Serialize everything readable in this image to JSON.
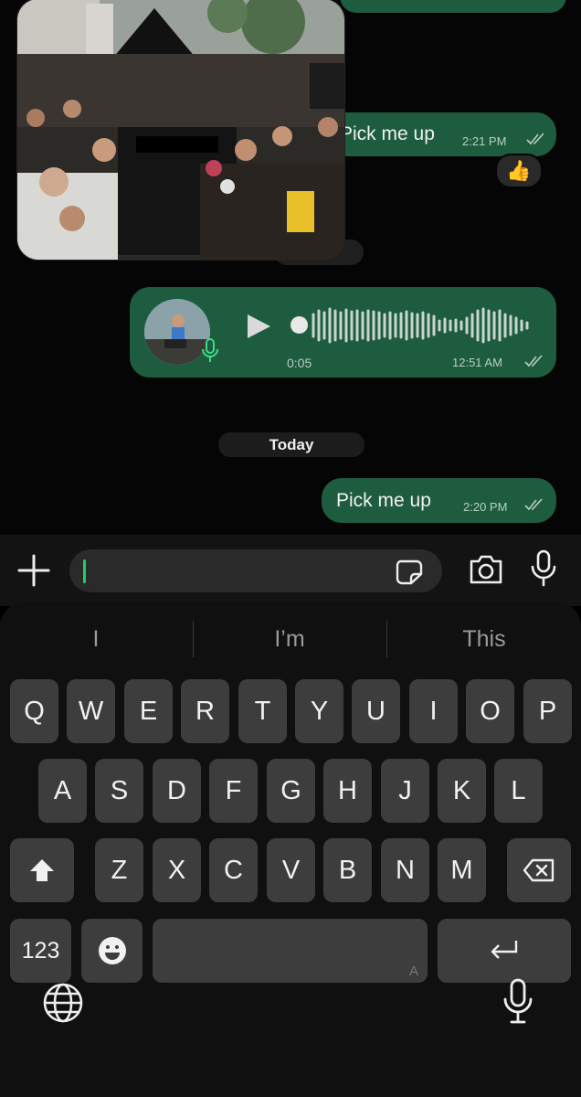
{
  "chat": {
    "messages": [
      {
        "text": "Pick me up",
        "time": "2:21 PM",
        "reaction": "👍"
      },
      {
        "voice_duration": "0:05",
        "time": "12:51 AM"
      },
      {
        "text": "Pick me up",
        "time": "2:20 PM"
      }
    ],
    "day_separator": "Today"
  },
  "input": {
    "placeholder": ""
  },
  "keyboard": {
    "suggestions": [
      "I",
      "I’m",
      "This"
    ],
    "row1": [
      "Q",
      "W",
      "E",
      "R",
      "T",
      "Y",
      "U",
      "I",
      "O",
      "P"
    ],
    "row2": [
      "A",
      "S",
      "D",
      "F",
      "G",
      "H",
      "J",
      "K",
      "L"
    ],
    "row3": [
      "Z",
      "X",
      "C",
      "V",
      "B",
      "N",
      "M"
    ],
    "numbers_key": "123",
    "space_hint": "A"
  },
  "icons": [
    "plus-icon",
    "sticker-icon",
    "camera-icon",
    "microphone-icon",
    "play-icon",
    "shift-icon",
    "backspace-icon",
    "emoji-icon",
    "return-icon",
    "globe-icon"
  ],
  "colors": {
    "outgoing_bubble": "#1d5c3f",
    "caret": "#1fcf6b",
    "background": "#000000",
    "key": "#3d3d3d"
  }
}
